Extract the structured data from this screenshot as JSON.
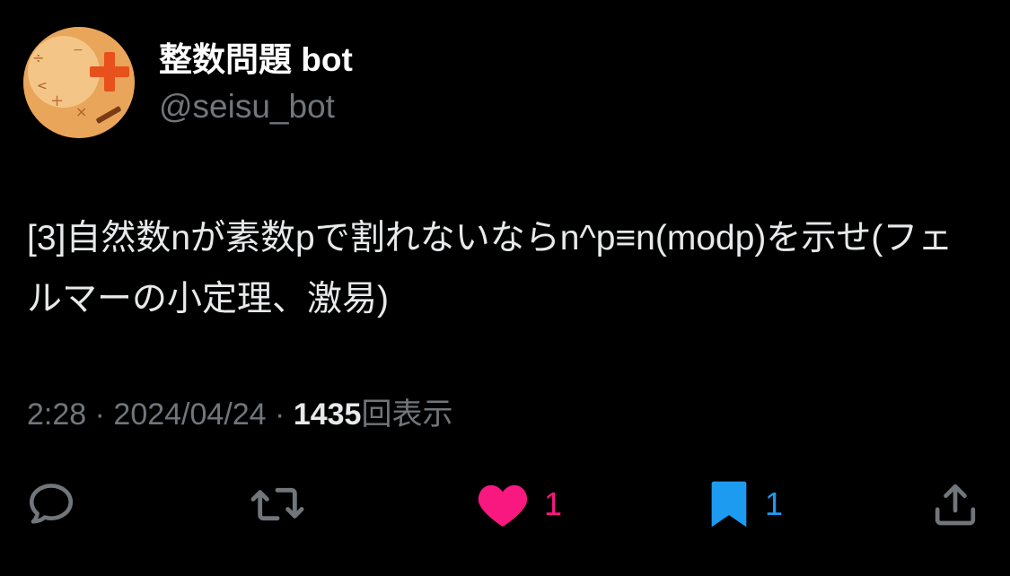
{
  "author": {
    "display_name": "整数問題 bot",
    "handle": "@seisu_bot"
  },
  "tweet": {
    "text": "[3]自然数nが素数pで割れないならn^p≡n(modp)を示せ(フェルマーの小定理、激易)"
  },
  "meta": {
    "time": "2:28",
    "separator": "·",
    "date": "2024/04/24",
    "views_count": "1435",
    "views_label": "回表示"
  },
  "actions": {
    "like_count": "1",
    "bookmark_count": "1"
  },
  "colors": {
    "background": "#000000",
    "text": "#e7e9ea",
    "secondary": "#71767b",
    "like": "#f91880",
    "bookmark": "#1d9bf0"
  },
  "icons": {
    "reply": "reply-icon",
    "retweet": "retweet-icon",
    "like": "heart-icon",
    "bookmark": "bookmark-icon",
    "share": "share-icon"
  }
}
